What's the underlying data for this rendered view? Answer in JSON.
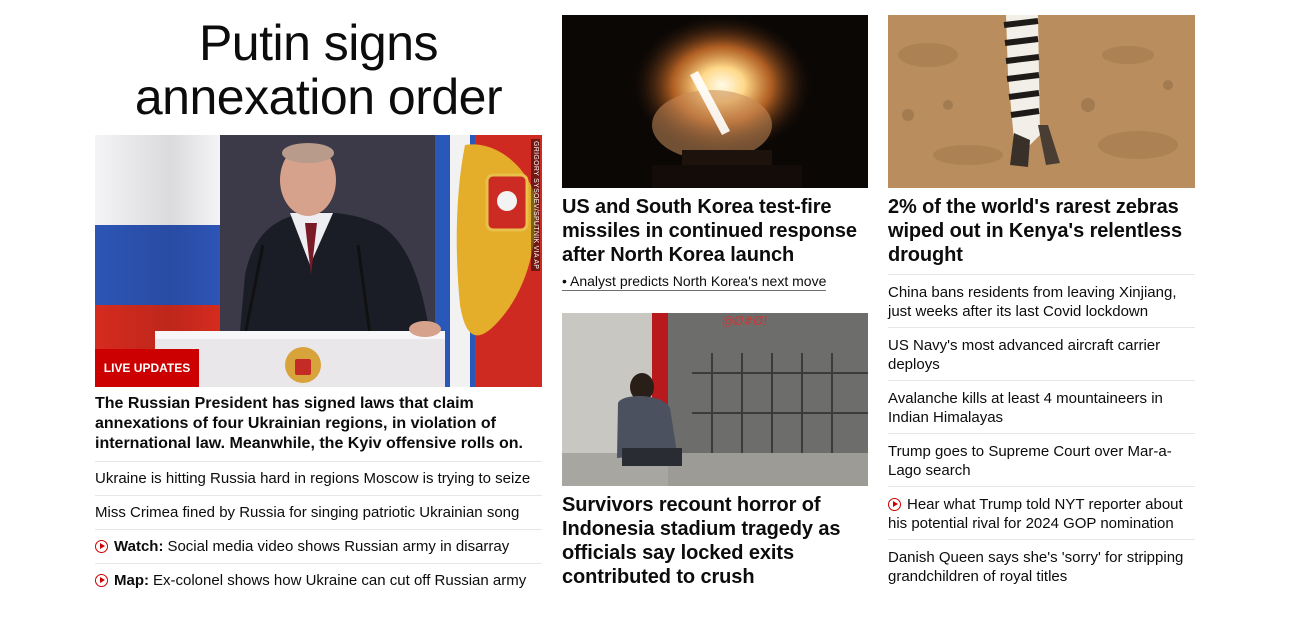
{
  "main_story": {
    "headline": "Putin signs annexation order",
    "image_credit": "GRIGORY SYSOEV/SPUTNIK VIA AP",
    "badge": "LIVE UPDATES",
    "summary": "The Russian President has signed laws that claim annexations of four Ukrainian regions, in violation of international law. Meanwhile, the Kyiv offensive rolls on.",
    "related": [
      {
        "prefix": "",
        "text": "Ukraine is hitting Russia hard in regions Moscow is trying to seize",
        "video": false
      },
      {
        "prefix": "",
        "text": "Miss Crimea fined by Russia for singing patriotic Ukrainian song",
        "video": false
      },
      {
        "prefix": "Watch:",
        "text": "Social media video shows Russian army in disarray",
        "video": true
      },
      {
        "prefix": "Map:",
        "text": "Ex-colonel shows how Ukraine can cut off Russian army",
        "video": true
      }
    ]
  },
  "center_column": {
    "missile_headline": "US and South Korea test-fire missiles in continued response after North Korea launch",
    "missile_sublink": "• Analyst predicts North Korea's next move",
    "stadium_headline": "Survivors recount horror of Indonesia stadium tragedy as officials say locked exits contributed to crush"
  },
  "right_column": {
    "zebra_headline": "2% of the world's rarest zebras wiped out in Kenya's relentless drought",
    "links": [
      {
        "text": "China bans residents from leaving Xinjiang, just weeks after its last Covid lockdown",
        "video": false
      },
      {
        "text": "US Navy's most advanced aircraft carrier deploys",
        "video": false
      },
      {
        "text": "Avalanche kills at least 4 mountaineers in Indian Himalayas",
        "video": false
      },
      {
        "text": "Trump goes to Supreme Court over Mar-a-Lago search",
        "video": false
      },
      {
        "text": "Hear what Trump told NYT reporter about his potential rival for 2024 GOP nomination",
        "video": true
      },
      {
        "text": "Danish Queen says she's 'sorry' for stripping grandchildren of royal titles",
        "video": false
      }
    ]
  },
  "colors": {
    "accent_red": "#cc0000",
    "text": "#0c0c0c",
    "divider": "#e6e6e6"
  },
  "icons": {
    "video": "play-circle-icon"
  }
}
